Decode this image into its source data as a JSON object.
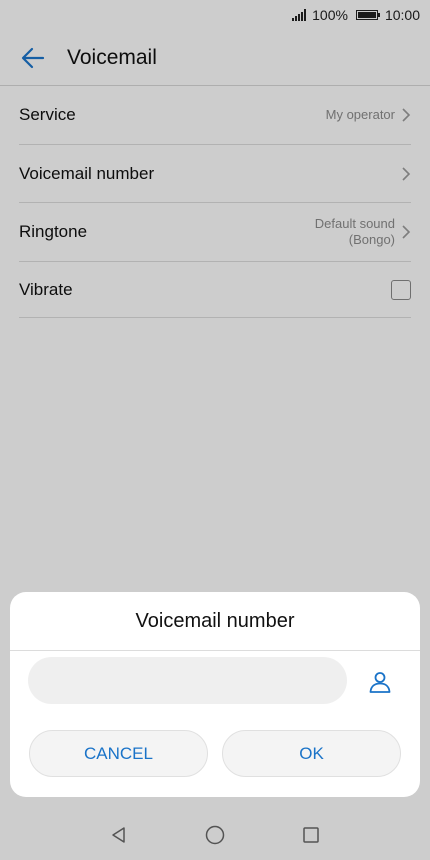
{
  "status_bar": {
    "battery_percent": "100%",
    "time": "10:00"
  },
  "app_bar": {
    "title": "Voicemail",
    "back_icon": "back-arrow-icon"
  },
  "settings": [
    {
      "label": "Service",
      "value": "My operator"
    },
    {
      "label": "Voicemail number",
      "value": ""
    },
    {
      "label": "Ringtone",
      "value_line1": "Default sound",
      "value_line2": "(Bongo)"
    },
    {
      "label": "Vibrate",
      "checked": false
    }
  ],
  "dialog": {
    "title": "Voicemail number",
    "input_value": "",
    "contact_icon": "contact-person-icon",
    "cancel_label": "CANCEL",
    "ok_label": "OK"
  },
  "colors": {
    "accent": "#1a73c8",
    "background": "#fafafa",
    "dim_overlay": "rgba(0,0,0,0.18)"
  },
  "nav_bar": {
    "icons": [
      "back-triangle-icon",
      "home-circle-icon",
      "recents-square-icon"
    ]
  }
}
